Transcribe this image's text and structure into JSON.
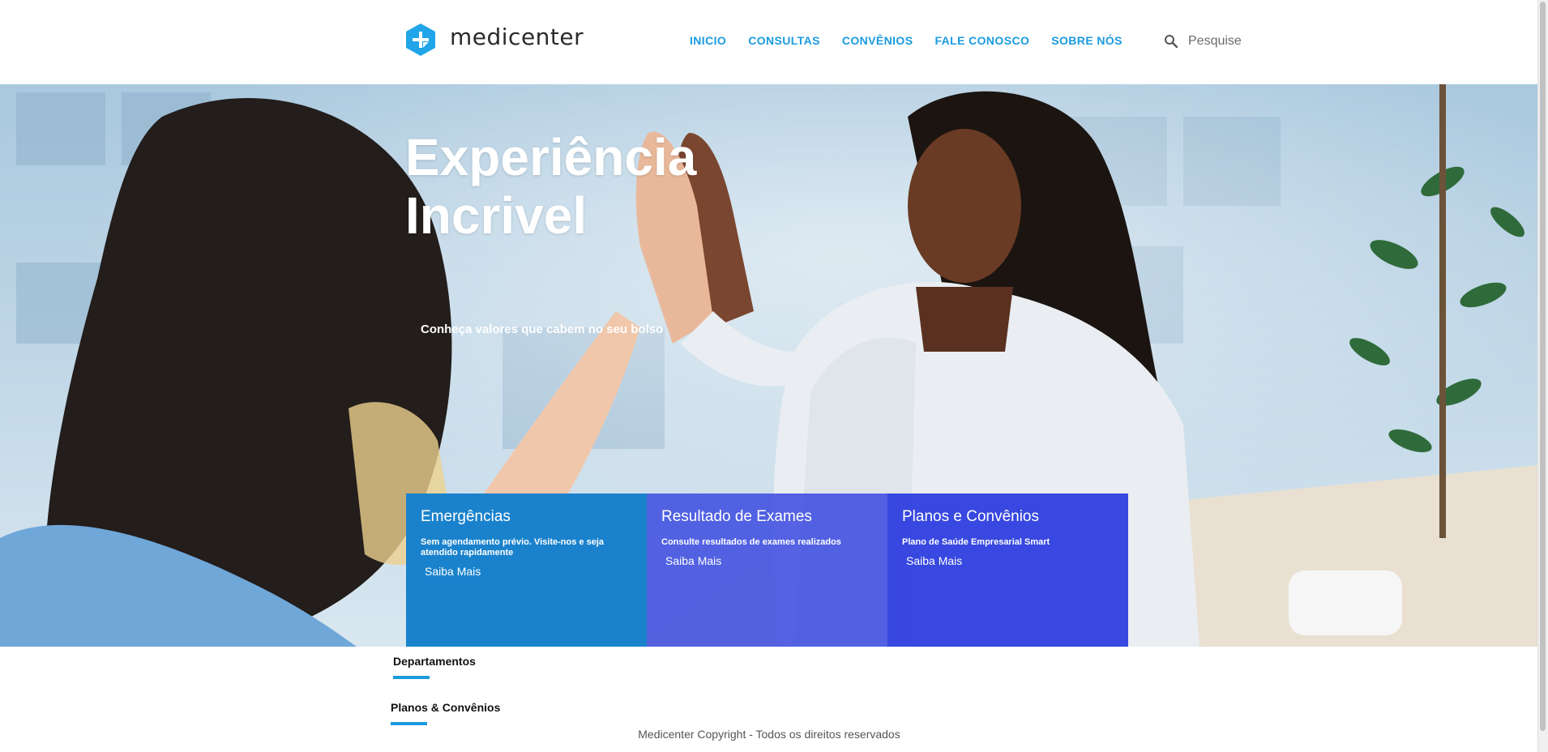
{
  "header": {
    "brand": "medicenter",
    "nav": [
      "INICIO",
      "CONSULTAS",
      "CONVÊNIOS",
      "FALE CONOSCO",
      "SOBRE NÓS"
    ],
    "search_placeholder": "Pesquise"
  },
  "hero": {
    "title_line1": "Experiência",
    "title_line2": "Incrivel",
    "subtitle": "Conheça valores que cabem no seu bolso"
  },
  "cards": [
    {
      "title": "Emergências",
      "description": "Sem agendamento prévio. Visite-nos e seja atendido rapidamente",
      "link": "Saiba Mais",
      "color": "#1a82cc"
    },
    {
      "title": "Resultado de Exames",
      "description": "Consulte resultados de exames realizados",
      "link": "Saiba Mais",
      "color": "#3f4fe0"
    },
    {
      "title": "Planos e Convênios",
      "description": "Plano de Saúde Empresarial Smart",
      "link": "Saiba Mais",
      "color": "#2839de"
    }
  ],
  "sections": {
    "departments": "Departamentos",
    "plans": "Planos & Convênios"
  },
  "footer": {
    "copyright": "Medicenter Copyright - Todos os direitos reservados"
  },
  "colors": {
    "accent": "#1a9be0",
    "brand_icon": "#1fa5e8"
  },
  "icons": {
    "logo": "plus-hexagon-icon",
    "search": "search-icon"
  }
}
